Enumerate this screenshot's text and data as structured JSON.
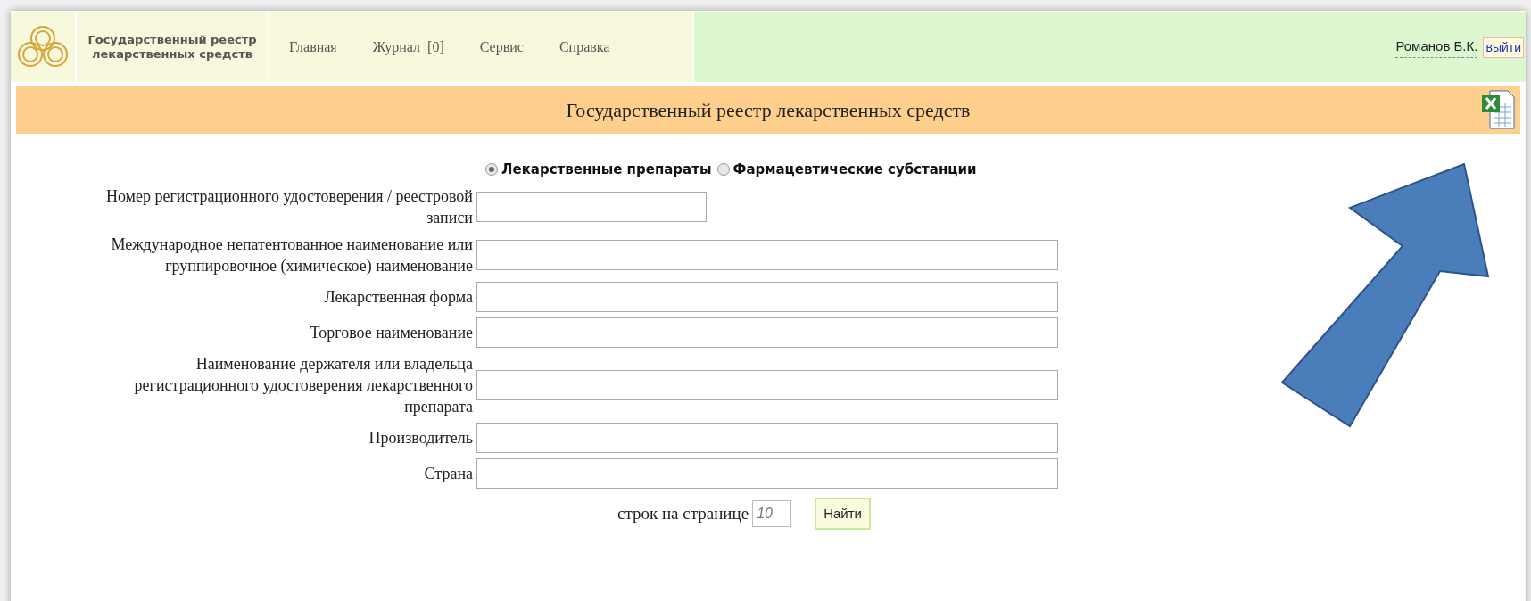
{
  "header": {
    "site_title": "Государственный реестр лекарственных средств",
    "nav": [
      {
        "label": "Главная"
      },
      {
        "label": "Журнал  [0]"
      },
      {
        "label": "Сервис"
      },
      {
        "label": "Справка"
      }
    ],
    "user": "Романов Б.К.",
    "logout": "выйти"
  },
  "banner": {
    "title": "Государственный реестр лекарственных средств"
  },
  "radios": [
    {
      "label": "Лекарственные препараты",
      "selected": true
    },
    {
      "label": "Фармацевтические субстанции",
      "selected": false
    }
  ],
  "fields": [
    {
      "label": "Номер регистрационного удостоверения / реестровой записи",
      "kind": "short"
    },
    {
      "label": "Международное непатентованное наименование или группировочное (химическое) наименование",
      "kind": "long"
    },
    {
      "label": "Лекарственная форма",
      "kind": "long"
    },
    {
      "label": "Торговое наименование",
      "kind": "long"
    },
    {
      "label": "Наименование держателя или владельца регистрационного удостоверения лекарственного препарата",
      "kind": "long"
    },
    {
      "label": "Производитель",
      "kind": "long"
    },
    {
      "label": "Страна",
      "kind": "long"
    }
  ],
  "footer": {
    "rows_label": "строк на странице",
    "rows_placeholder": "10",
    "button": "Найти"
  }
}
